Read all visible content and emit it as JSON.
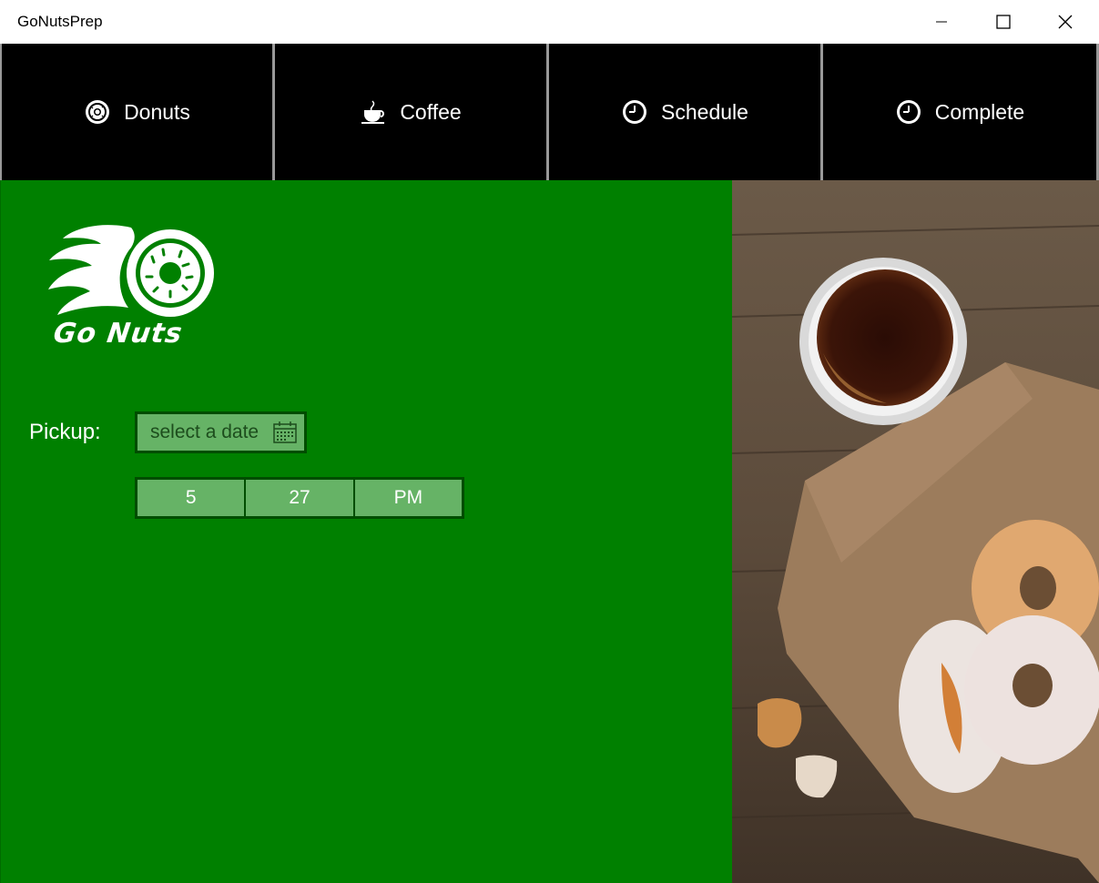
{
  "window": {
    "title": "GoNutsPrep",
    "minimize_icon": "minimize-icon",
    "maximize_icon": "maximize-icon",
    "close_icon": "close-icon"
  },
  "nav": {
    "tabs": [
      {
        "label": "Donuts",
        "icon": "donut-icon"
      },
      {
        "label": "Coffee",
        "icon": "coffee-cup-icon"
      },
      {
        "label": "Schedule",
        "icon": "clock-icon"
      },
      {
        "label": "Complete",
        "icon": "clock-icon"
      }
    ]
  },
  "main": {
    "logo_text": "Go Nuts",
    "pickup_label": "Pickup:",
    "date_placeholder": "select a date",
    "time": {
      "hour": "5",
      "minute": "27",
      "period": "PM"
    }
  },
  "colors": {
    "nav_bg": "#000000",
    "main_bg": "#008000",
    "field_bg": "#66b366",
    "field_border": "#004d00"
  }
}
